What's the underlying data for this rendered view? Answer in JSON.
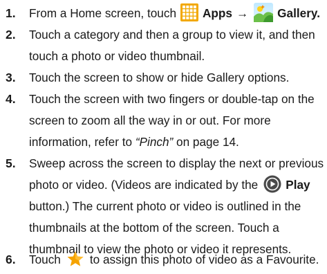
{
  "steps": [
    {
      "number": "1.",
      "lines": [
        {
          "text_a": "From a Home screen, touch",
          "icon_a": "apps-grid-icon",
          "label_a": "Apps",
          "arrow": "→",
          "icon_b": "gallery-icon",
          "label_b": "Gallery",
          "end": "."
        }
      ]
    },
    {
      "number": "2.",
      "lines": [
        "Touch a category and then a group to view it, and then",
        "touch a photo or video thumbnail."
      ]
    },
    {
      "number": "3.",
      "lines": [
        "Touch the screen to show or hide Gallery options."
      ]
    },
    {
      "number": "4.",
      "lines": [
        "Touch the screen with two fingers or double-tap on the",
        "screen to zoom all the way in or out. For more",
        {
          "text_a": "information, refer to ",
          "ref": "“Pinch”",
          "text_b": " on page 14."
        }
      ]
    },
    {
      "number": "5.",
      "lines": [
        "Sweep across the screen to display the next or previous",
        {
          "text_a": "photo or video. (Videos are indicated by the",
          "icon": "play-icon",
          "label": "Play"
        },
        "button.) The current photo or video is outlined in the",
        "thumbnails at the bottom of the screen. Touch a",
        "thumbnail to view the photo or video it represents."
      ]
    },
    {
      "number": "6.",
      "lines": [
        {
          "text_a": "Touch",
          "icon": "star-icon",
          "text_b": "to assign this photo of video as a Favourite."
        }
      ]
    }
  ],
  "colors": {
    "apps_icon": "#f2a800",
    "play_icon": "#4a4a4a",
    "star_icon": "#f5a300",
    "gallery_green": "#6cc04a",
    "gallery_yellow": "#ffd21a",
    "text": "#1a1a1a"
  }
}
